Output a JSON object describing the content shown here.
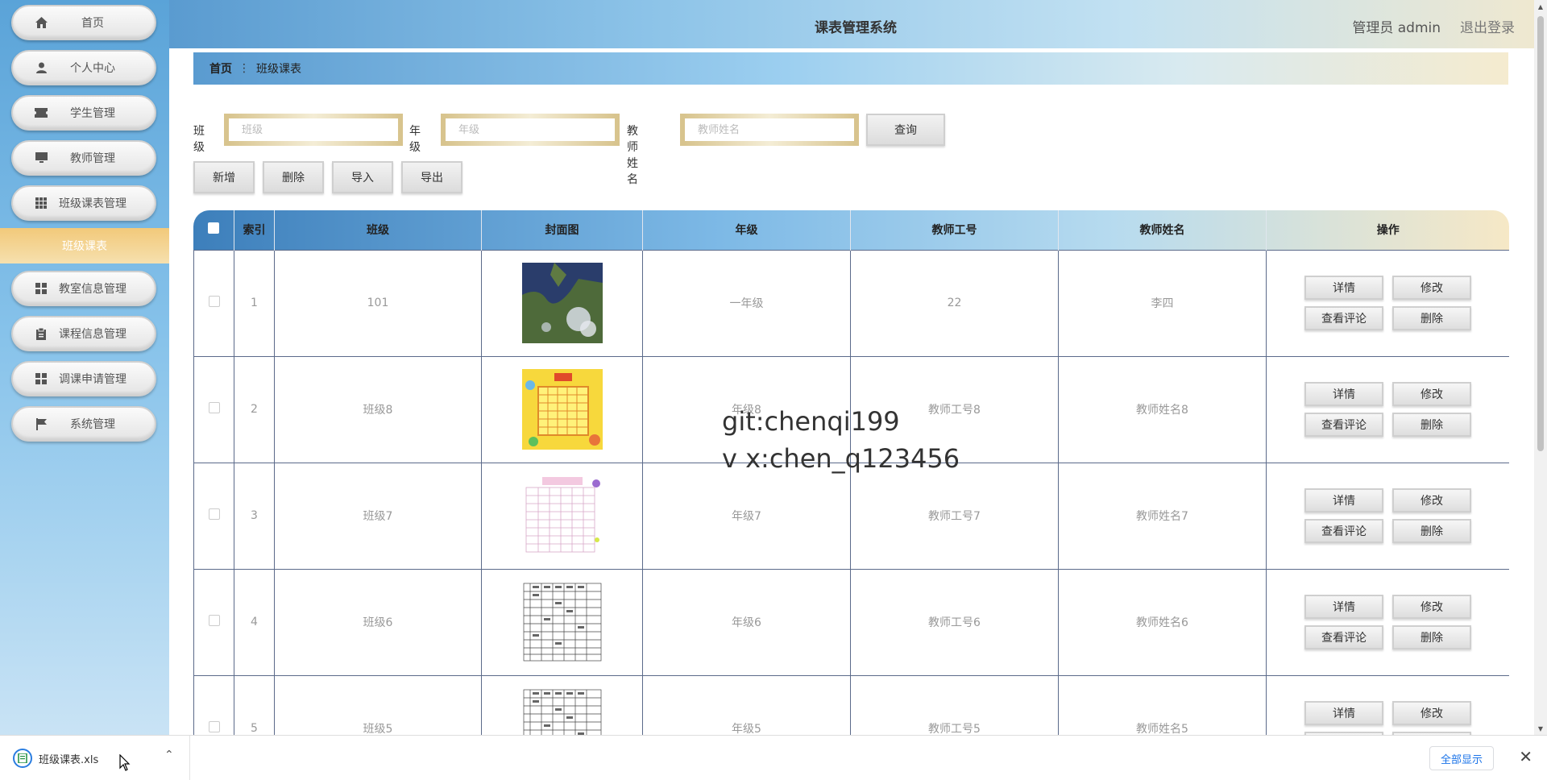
{
  "header": {
    "title": "课表管理系统",
    "user": "管理员 admin",
    "logout": "退出登录"
  },
  "sidebar": {
    "items": [
      {
        "label": "首页",
        "icon": "home-icon"
      },
      {
        "label": "个人中心",
        "icon": "user-icon"
      },
      {
        "label": "学生管理",
        "icon": "ticket-icon"
      },
      {
        "label": "教师管理",
        "icon": "monitor-icon"
      },
      {
        "label": "班级课表管理",
        "icon": "grid-icon"
      }
    ],
    "active": "班级课表",
    "items2": [
      {
        "label": "教室信息管理",
        "icon": "grid-icon"
      },
      {
        "label": "课程信息管理",
        "icon": "clipboard-icon"
      },
      {
        "label": "调课申请管理",
        "icon": "grid-icon"
      },
      {
        "label": "系统管理",
        "icon": "flag-icon"
      }
    ]
  },
  "breadcrumb": {
    "home": "首页",
    "sep": "⋮",
    "current": "班级课表"
  },
  "search": {
    "class_label": "班级",
    "class_placeholder": "班级",
    "grade_label": "年级",
    "grade_placeholder": "年级",
    "teacher_label": "教师姓名",
    "teacher_placeholder": "教师姓名",
    "query_button": "查询"
  },
  "toolbar": {
    "add": "新增",
    "delete": "删除",
    "import": "导入",
    "export": "导出"
  },
  "table": {
    "headers": [
      "索引",
      "班级",
      "封面图",
      "年级",
      "教师工号",
      "教师姓名",
      "操作"
    ],
    "rows": [
      {
        "index": "1",
        "class": "101",
        "grade": "一年级",
        "teacher_id": "22",
        "teacher_name": "李四",
        "image": "satellite-map"
      },
      {
        "index": "2",
        "class": "班级8",
        "grade": "年级8",
        "teacher_id": "教师工号8",
        "teacher_name": "教师姓名8",
        "image": "yellow-schedule"
      },
      {
        "index": "3",
        "class": "班级7",
        "grade": "年级7",
        "teacher_id": "教师工号7",
        "teacher_name": "教师姓名7",
        "image": "pink-schedule"
      },
      {
        "index": "4",
        "class": "班级6",
        "grade": "年级6",
        "teacher_id": "教师工号6",
        "teacher_name": "教师姓名6",
        "image": "grid-schedule"
      },
      {
        "index": "5",
        "class": "班级5",
        "grade": "年级5",
        "teacher_id": "教师工号5",
        "teacher_name": "教师姓名5",
        "image": "grid-schedule"
      }
    ],
    "ops": {
      "detail": "详情",
      "edit": "修改",
      "comments": "查看评论",
      "delete": "删除"
    }
  },
  "watermark": {
    "line1": "git:chenqi199",
    "line2": "v x:chen_q123456"
  },
  "download": {
    "filename": "班级课表.xls",
    "show_all": "全部显示",
    "close": "✕"
  }
}
